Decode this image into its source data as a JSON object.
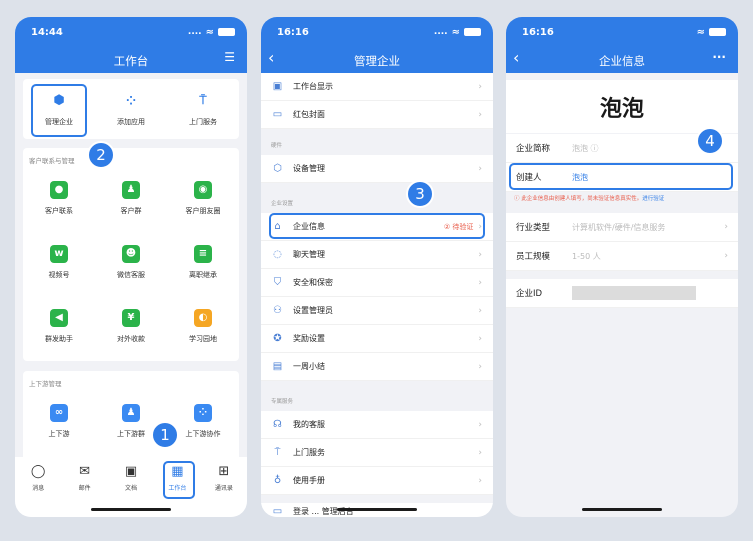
{
  "status": {
    "time1": "14:44",
    "time2": "16:16",
    "time3": "16:16",
    "dots": "....",
    "wifi": "≈"
  },
  "workbench": {
    "title": "工作台",
    "top_apps": [
      "管理企业",
      "添加应用",
      "上门服务"
    ],
    "sect_customer": "客户联系与管理",
    "customer_apps": [
      "客户联系",
      "客户群",
      "客户朋友圈",
      "视频号",
      "微信客服",
      "离职继承",
      "群发助手",
      "对外收款",
      "学习园地"
    ],
    "sect_updown": "上下游管理",
    "updown_apps": [
      "上下游",
      "上下游群",
      "上下游协作"
    ],
    "tabs": [
      "消息",
      "邮件",
      "文档",
      "工作台",
      "通讯录"
    ]
  },
  "manage": {
    "title": "管理企业",
    "group1": [
      "工作台显示",
      "红包封面"
    ],
    "label_hw": "硬件",
    "group2": [
      "设备管理"
    ],
    "label_ent": "企业设置",
    "group3": [
      "企业信息",
      "聊天管理",
      "安全和保密",
      "设置管理员",
      "奖励设置",
      "一周小结"
    ],
    "pending": "② 待验证",
    "label_service": "专属服务",
    "group4": [
      "我的客服",
      "上门服务",
      "使用手册"
    ],
    "bottom_cut": "登录 ... 管理后台"
  },
  "info": {
    "title": "企业信息",
    "more": "...",
    "company_name": "泡泡",
    "short_name_label": "企业简称",
    "short_name_value": "泡泡 ⓘ",
    "creator_label": "创建人",
    "creator_value": "泡泡",
    "notice": "ⓘ 此企业信息由创建人填写，尚未验证信息真实性。",
    "notice_link": "进行验证",
    "industry_label": "行业类型",
    "industry_value": "计算机软件/硬件/信息服务",
    "size_label": "员工规模",
    "size_value": "1-50 人",
    "id_label": "企业ID"
  },
  "badges": [
    "1",
    "2",
    "3",
    "4"
  ],
  "colors": {
    "accent": "#2f7ce6",
    "green": "#2bb34a",
    "orange": "#f5a623",
    "red": "#e85c4a"
  }
}
